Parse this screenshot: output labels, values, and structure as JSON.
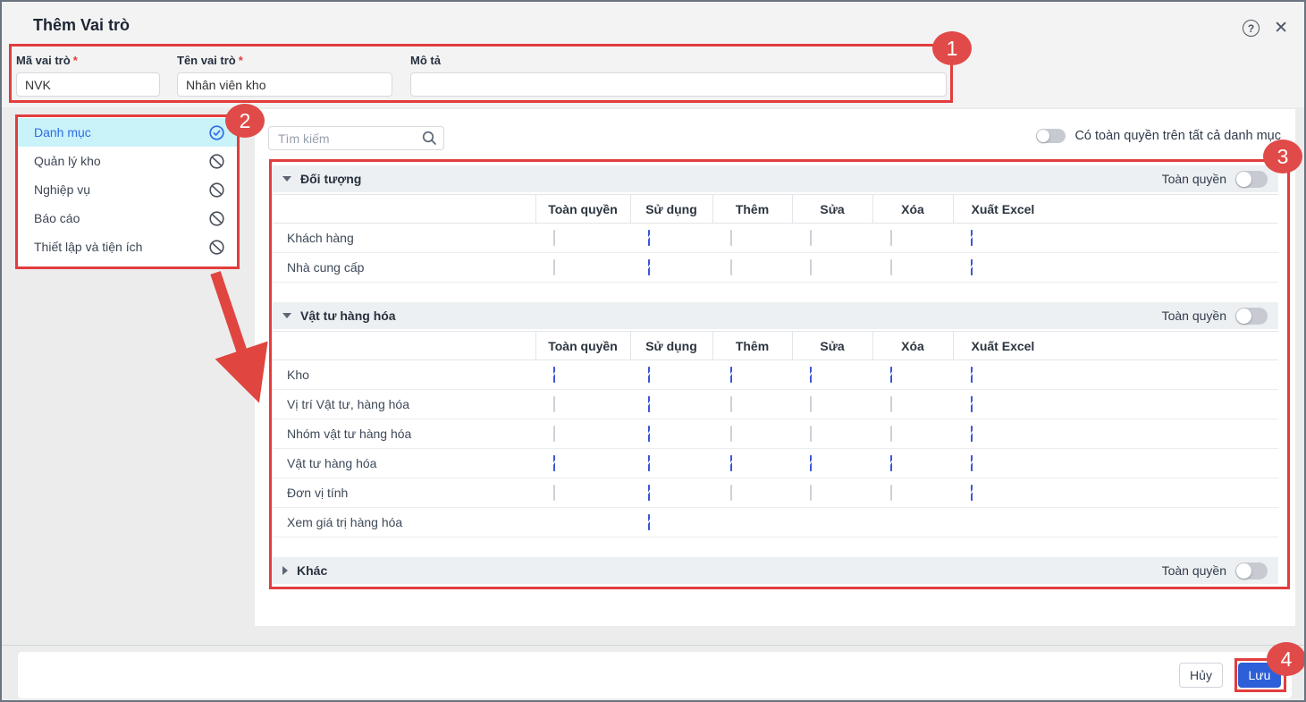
{
  "window": {
    "title": "Thêm Vai trò"
  },
  "form": {
    "required_mark": "*",
    "fields": [
      {
        "label": "Mã vai trò",
        "required": true,
        "value": "NVK"
      },
      {
        "label": "Tên vai trò",
        "required": true,
        "value": "Nhân viên kho"
      },
      {
        "label": "Mô tả",
        "required": false,
        "value": ""
      }
    ]
  },
  "sidebar": {
    "items": [
      {
        "label": "Danh mục",
        "selected": true,
        "icon": "check-circle"
      },
      {
        "label": "Quản lý kho",
        "selected": false,
        "icon": "no-access"
      },
      {
        "label": "Nghiệp vụ",
        "selected": false,
        "icon": "no-access"
      },
      {
        "label": "Báo cáo",
        "selected": false,
        "icon": "no-access"
      },
      {
        "label": "Thiết lập và tiện ích",
        "selected": false,
        "icon": "no-access"
      }
    ]
  },
  "search": {
    "placeholder": "Tìm kiếm"
  },
  "global_toggle": {
    "label": "Có toàn quyền trên tất cả danh mục",
    "on": false
  },
  "permissions": {
    "columns": [
      "Toàn quyền",
      "Sử dụng",
      "Thêm",
      "Sửa",
      "Xóa",
      "Xuất Excel"
    ],
    "full_permission_label": "Toàn quyền",
    "sections": [
      {
        "title": "Đối tượng",
        "expanded": true,
        "toggle_on": false,
        "rows": [
          {
            "label": "Khách hàng",
            "checks": [
              0,
              1,
              0,
              0,
              0,
              1
            ]
          },
          {
            "label": "Nhà cung cấp",
            "checks": [
              0,
              1,
              0,
              0,
              0,
              1
            ]
          }
        ]
      },
      {
        "title": "Vật tư hàng hóa",
        "expanded": true,
        "toggle_on": false,
        "rows": [
          {
            "label": "Kho",
            "checks": [
              1,
              1,
              1,
              1,
              1,
              1
            ]
          },
          {
            "label": "Vị trí Vật tư, hàng hóa",
            "checks": [
              0,
              1,
              0,
              0,
              0,
              1
            ]
          },
          {
            "label": "Nhóm vật tư hàng hóa",
            "checks": [
              0,
              1,
              0,
              0,
              0,
              1
            ]
          },
          {
            "label": "Vật tư hàng hóa",
            "checks": [
              1,
              1,
              1,
              1,
              1,
              1
            ]
          },
          {
            "label": "Đơn vị tính",
            "checks": [
              0,
              1,
              0,
              0,
              0,
              1
            ]
          },
          {
            "label": "Xem giá trị hàng hóa",
            "checks": [
              null,
              1,
              null,
              null,
              null,
              null
            ]
          }
        ]
      },
      {
        "title": "Khác",
        "expanded": false,
        "toggle_on": false,
        "rows": []
      }
    ]
  },
  "footer": {
    "cancel_label": "Hủy",
    "save_label": "Lưu"
  },
  "annotations": {
    "badge1": "1",
    "badge2": "2",
    "badge3": "3",
    "badge4": "4"
  },
  "colors": {
    "annotation_red": "#e23d3d",
    "checkbox_blue": "#3b56d9",
    "primary_blue": "#2d5fd9",
    "selected_item_bg": "#c9f2f9",
    "selected_item_text": "#2e6ce6"
  }
}
